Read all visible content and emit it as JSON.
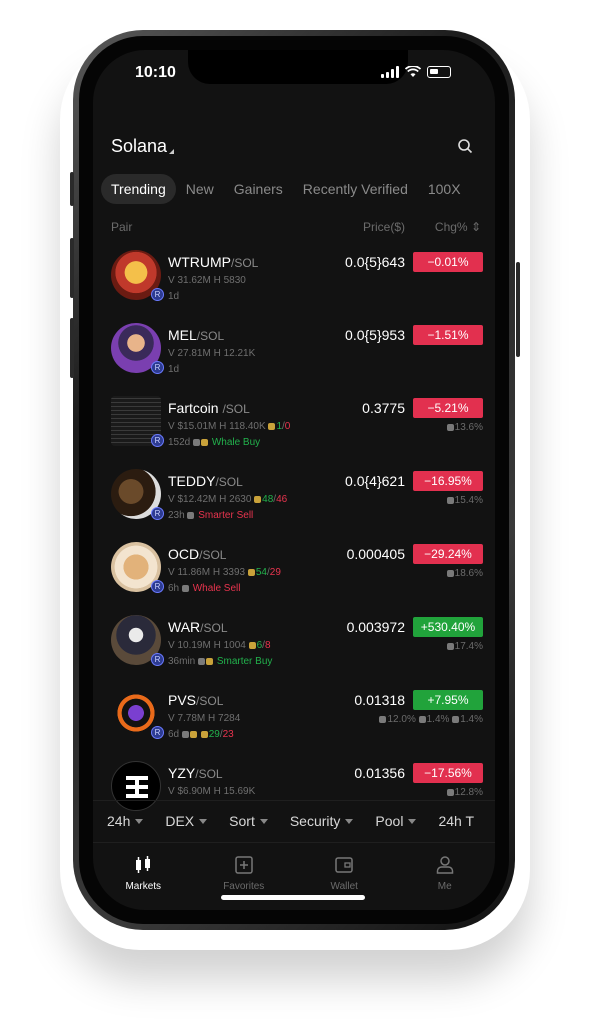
{
  "status": {
    "time": "10:10"
  },
  "header": {
    "chain": "Solana"
  },
  "tabs": [
    {
      "label": "Trending"
    },
    {
      "label": "New"
    },
    {
      "label": "Gainers"
    },
    {
      "label": "Recently Verified"
    },
    {
      "label": "100X"
    }
  ],
  "columns": {
    "pair": "Pair",
    "price": "Price($)",
    "chg": "Chg%"
  },
  "rows": [
    {
      "base": "WTRUMP",
      "quote": "/SOL",
      "vol": "V 31.62M  H 5830",
      "meta": "1d",
      "price": "0.0{5}643",
      "chg": "−0.01%",
      "sub": ""
    },
    {
      "base": "MEL",
      "quote": "/SOL",
      "vol": "V 27.81M  H 12.21K",
      "meta": "1d",
      "price": "0.0{5}953",
      "chg": "−1.51%",
      "sub": ""
    },
    {
      "base": "Fartcoin ",
      "quote": "/SOL",
      "vol": "V $15.01M  H 118.40K",
      "counts_a": "1",
      "counts_b": "0",
      "meta": "152d",
      "tag": "Whale Buy",
      "price": "0.3775",
      "chg": "−5.21%",
      "sub": "13.6%"
    },
    {
      "base": "TEDDY",
      "quote": "/SOL",
      "vol": "V $12.42M  H 2630",
      "counts_a": "48",
      "counts_b": "46",
      "meta": "23h",
      "tag": "Smarter Sell",
      "price": "0.0{4}621",
      "chg": "−16.95%",
      "sub": "15.4%"
    },
    {
      "base": "OCD",
      "quote": "/SOL",
      "vol": "V 11.86M  H 3393",
      "counts_a": "54",
      "counts_b": "29",
      "meta": "6h",
      "tag": "Whale Sell",
      "price": "0.000405",
      "chg": "−29.24%",
      "sub": "18.6%"
    },
    {
      "base": "WAR",
      "quote": "/SOL",
      "vol": "V 10.19M  H 1004",
      "counts_a": "6",
      "counts_b": "8",
      "meta": "36min",
      "tag": "Smarter Buy",
      "price": "0.003972",
      "chg": "+530.40%",
      "sub": "17.4%"
    },
    {
      "base": "PVS",
      "quote": "/SOL",
      "vol": "V 7.78M  H 7284",
      "counts_a": "29",
      "counts_b": "23",
      "meta": "6d",
      "price": "0.01318",
      "chg": "+7.95%",
      "sub_a": "12.0%",
      "sub_b": "1.4%",
      "sub_c": "1.4%"
    },
    {
      "base": "YZY",
      "quote": "/SOL",
      "vol": "V $6.90M  H 15.69K",
      "price": "0.01356",
      "chg": "−17.56%",
      "sub": "12.8%"
    }
  ],
  "filters": [
    {
      "label": "24h"
    },
    {
      "label": "DEX"
    },
    {
      "label": "Sort"
    },
    {
      "label": "Security"
    },
    {
      "label": "Pool"
    },
    {
      "label": "24h T"
    }
  ],
  "nav": [
    {
      "label": "Markets"
    },
    {
      "label": "Favorites"
    },
    {
      "label": "Wallet"
    },
    {
      "label": "Me"
    }
  ],
  "colors": {
    "negative": "#e2304f",
    "positive": "#21a33b",
    "background": "#121212"
  }
}
